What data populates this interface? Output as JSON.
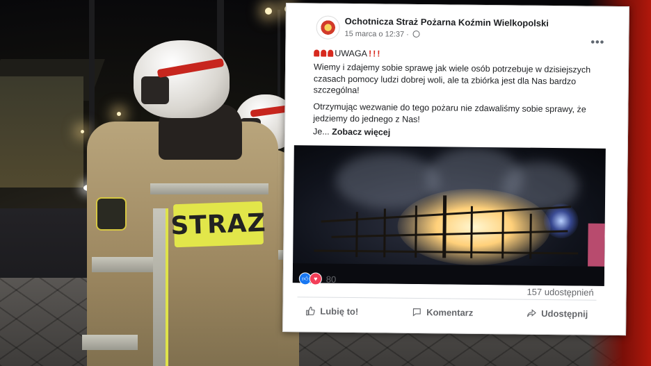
{
  "post": {
    "page_name": "Ochotnicza Straż Pożarna Koźmin Wielkopolski",
    "date": "15 marca o 12:37",
    "date_sep": "·",
    "uwaga": "UWAGA",
    "paragraph1": "Wiemy i zdajemy sobie sprawę jak wiele osób potrzebuje w dzisiejszych czasach pomocy ludzi dobrej woli, ale ta zbiórka jest dla Nas bardzo szczególna!",
    "paragraph2": "Otrzymując wezwanie do tego pożaru nie zdawaliśmy sobie sprawy, że jedziemy do jednego z Nas!",
    "paragraph3_start": "Je...",
    "see_more": "Zobacz więcej",
    "reaction_count": "80",
    "shares": "157 udostępnień",
    "actions": {
      "like": "Lubię to!",
      "comment": "Komentarz",
      "share": "Udostępnij"
    }
  },
  "background": {
    "jacket_label": "STRAZ"
  },
  "icons": {
    "more": "more-options-icon",
    "like": "thumbs-up-icon",
    "comment": "comment-icon",
    "share": "share-arrow-icon",
    "reaction_like": "like-reaction-icon",
    "reaction_love": "love-reaction-icon"
  },
  "colors": {
    "facebook_blue": "#1877f2",
    "love_red": "#f33e58",
    "text_dark": "#1c1e21",
    "text_muted": "#65676b",
    "siren_red": "#d7291e"
  }
}
